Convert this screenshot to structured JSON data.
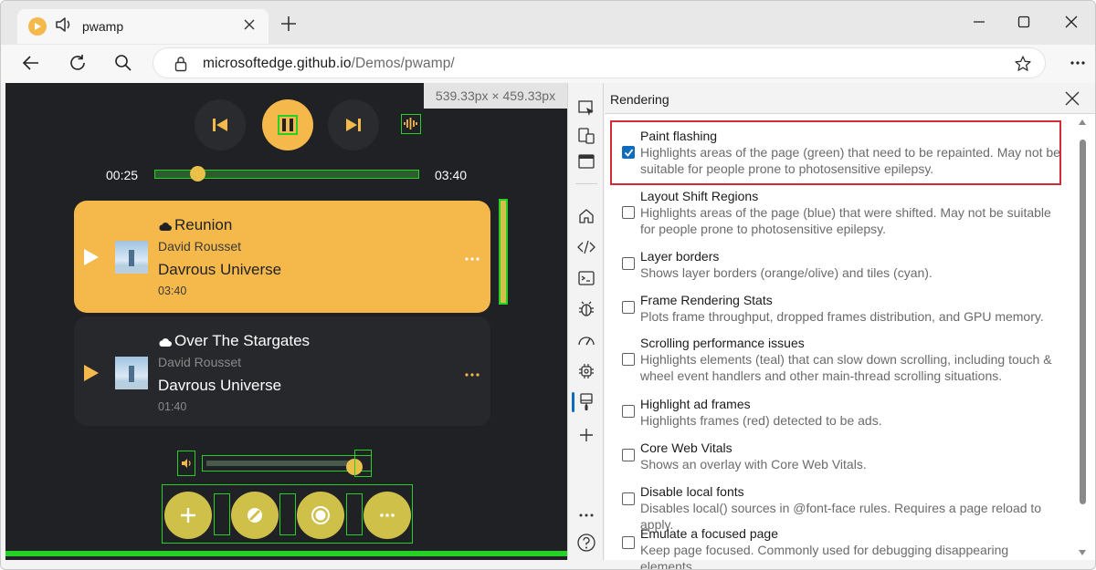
{
  "browser": {
    "tab": {
      "title": "pwamp"
    },
    "address": {
      "domain": "microsoftedge.github.io",
      "path": "/Demos/pwamp/"
    }
  },
  "viewport": {
    "dimensions": "539.33px × 459.33px",
    "player": {
      "elapsed": "00:25",
      "total": "03:40",
      "progress_fraction": 0.14,
      "volume_fraction": 0.95
    },
    "tracks": [
      {
        "title": "Reunion",
        "artist": "David Rousset",
        "album": "Davrous Universe",
        "duration": "03:40",
        "active": true
      },
      {
        "title": "Over The Stargates",
        "artist": "David Rousset",
        "album": "Davrous Universe",
        "duration": "01:40",
        "active": false
      }
    ],
    "colors": {
      "accent": "#f5b84a",
      "paint_flash": "#26d026",
      "background": "#1f2124"
    }
  },
  "devtools": {
    "activity_icons": [
      "inspect-icon",
      "device-emulation-icon",
      "dock-icon",
      "welcome-home-icon",
      "elements-code-icon",
      "console-icon",
      "sources-bug-icon",
      "performance-icon",
      "memory-chip-icon",
      "rendering-brush-icon",
      "add-tool-icon",
      "more-tools-icon",
      "help-icon"
    ],
    "panel": {
      "title": "Rendering",
      "options": [
        {
          "label": "Paint flashing",
          "desc": "Highlights areas of the page (green) that need to be repainted. May not be suitable for people prone to photosensitive epilepsy.",
          "checked": true
        },
        {
          "label": "Layout Shift Regions",
          "desc": "Highlights areas of the page (blue) that were shifted. May not be suitable for people prone to photosensitive epilepsy.",
          "checked": false
        },
        {
          "label": "Layer borders",
          "desc": "Shows layer borders (orange/olive) and tiles (cyan).",
          "checked": false
        },
        {
          "label": "Frame Rendering Stats",
          "desc": "Plots frame throughput, dropped frames distribution, and GPU memory.",
          "checked": false
        },
        {
          "label": "Scrolling performance issues",
          "desc": "Highlights elements (teal) that can slow down scrolling, including touch & wheel event handlers and other main-thread scrolling situations.",
          "checked": false
        },
        {
          "label": "Highlight ad frames",
          "desc": "Highlights frames (red) detected to be ads.",
          "checked": false
        },
        {
          "label": "Core Web Vitals",
          "desc": "Shows an overlay with Core Web Vitals.",
          "checked": false
        },
        {
          "label": "Disable local fonts",
          "desc": "Disables local() sources in @font-face rules. Requires a page reload to apply.",
          "checked": false
        },
        {
          "label": "Emulate a focused page",
          "desc": "Keep page focused. Commonly used for debugging disappearing elements.",
          "checked": false
        }
      ]
    }
  }
}
